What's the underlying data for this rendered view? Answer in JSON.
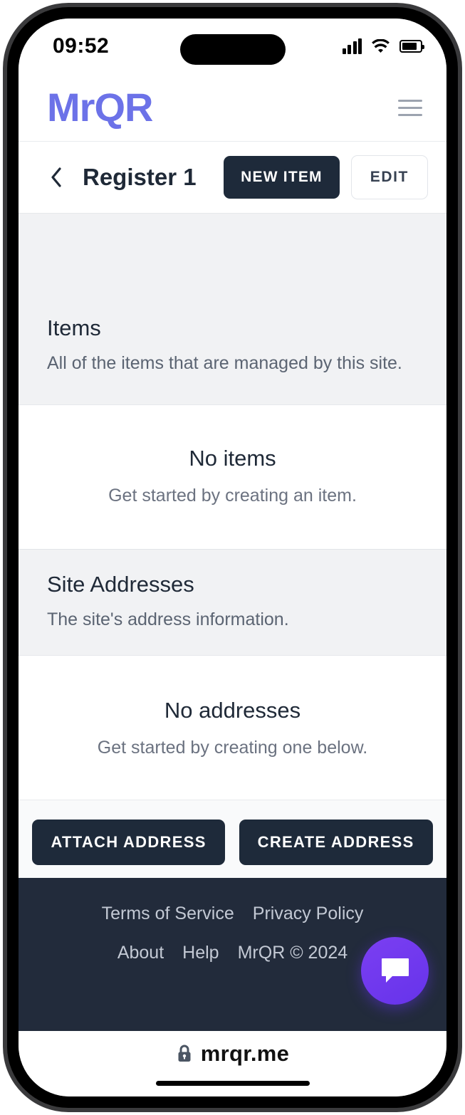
{
  "status_bar": {
    "time": "09:52",
    "signal_icon": "cellular-signal-icon",
    "wifi_icon": "wifi-icon",
    "battery_icon": "battery-icon"
  },
  "app_header": {
    "brand": "MrQR",
    "menu_icon": "hamburger-menu-icon"
  },
  "title_bar": {
    "back_icon": "chevron-left-icon",
    "title": "Register 1",
    "new_item_label": "NEW ITEM",
    "edit_label": "EDIT"
  },
  "items_section": {
    "title": "Items",
    "subtitle": "All of the items that are managed by this site.",
    "empty_title": "No items",
    "empty_subtitle": "Get started by creating an item."
  },
  "addresses_section": {
    "title": "Site Addresses",
    "subtitle": "The site's address information.",
    "empty_title": "No addresses",
    "empty_subtitle": "Get started by creating one below.",
    "attach_label": "ATTACH ADDRESS",
    "create_label": "CREATE ADDRESS"
  },
  "footer": {
    "terms_label": "Terms of Service",
    "privacy_label": "Privacy Policy",
    "about_label": "About",
    "help_label": "Help",
    "copyright": "MrQR © 2024",
    "chat_icon": "chat-bubble-icon"
  },
  "browser": {
    "lock_icon": "lock-icon",
    "url": "mrqr.me"
  },
  "colors": {
    "brand": "#6C72E8",
    "dark_button": "#1e2a3a",
    "footer_bg": "#222b3b",
    "section_bg": "#f1f2f4",
    "chat_fab": "#6633ea"
  }
}
